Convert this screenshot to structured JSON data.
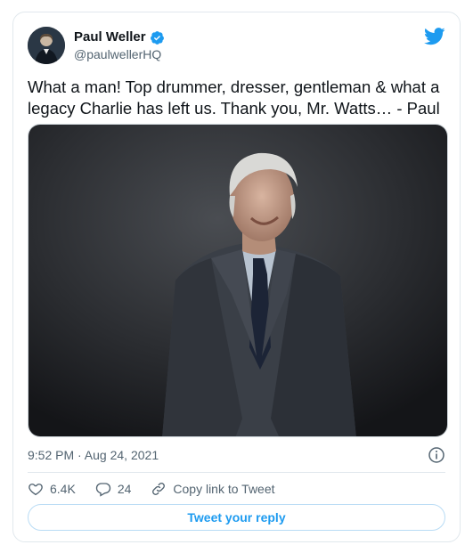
{
  "tweet": {
    "display_name": "Paul Weller",
    "handle": "@paulwellerHQ",
    "text": "What a man! Top drummer, dresser, gentleman & what a legacy Charlie has left us. Thank you, Mr. Watts… - Paul",
    "timestamp": "9:52 PM · Aug 24, 2021"
  },
  "actions": {
    "likes": "6.4K",
    "replies": "24",
    "copy_link_label": "Copy link to Tweet"
  },
  "reply_button_label": "Tweet your reply",
  "colors": {
    "accent": "#1d9bf0",
    "muted_text": "#536471",
    "border": "#e1e8ed"
  },
  "icons": [
    "verified-badge-icon",
    "twitter-bird-icon",
    "info-icon",
    "heart-icon",
    "reply-bubble-icon",
    "link-icon"
  ]
}
